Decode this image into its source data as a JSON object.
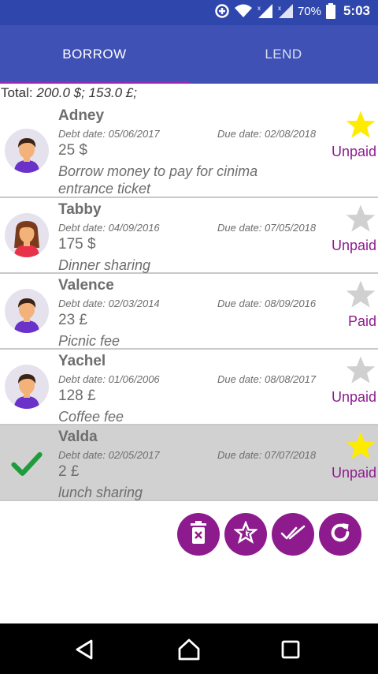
{
  "status_bar": {
    "battery": "70%",
    "time": "5:03"
  },
  "tabs": [
    {
      "label": "BORROW"
    },
    {
      "label": "LEND"
    }
  ],
  "total": {
    "label": "Total:",
    "value": "200.0 $; 153.0 £;"
  },
  "debts": [
    {
      "name": "Adney",
      "debt_date": "Debt date: 05/06/2017",
      "due_date": "Due date: 02/08/2018",
      "amount": "25 $",
      "description": "Borrow money to pay for cinima entrance ticket",
      "status": "Unpaid",
      "starred": true,
      "avatar": "male-avatar"
    },
    {
      "name": "Tabby",
      "debt_date": "Debt date: 04/09/2016",
      "due_date": "Due date: 07/05/2018",
      "amount": "175 $",
      "description": "Dinner sharing",
      "status": "Unpaid",
      "starred": false,
      "avatar": "female-avatar"
    },
    {
      "name": "Valence",
      "debt_date": "Debt date: 02/03/2014",
      "due_date": "Due date: 08/09/2016",
      "amount": "23 £",
      "description": "Picnic fee",
      "status": "Paid",
      "starred": false,
      "avatar": "male-avatar"
    },
    {
      "name": "Yachel",
      "debt_date": "Debt date: 01/06/2006",
      "due_date": "Due date: 08/08/2017",
      "amount": "128 £",
      "description": "Coffee fee",
      "status": "Unpaid",
      "starred": false,
      "avatar": "male-avatar"
    },
    {
      "name": "Valda",
      "debt_date": "Debt date: 02/05/2017",
      "due_date": "Due date: 07/07/2018",
      "amount": "2 £",
      "description": "lunch sharing",
      "status": "Unpaid",
      "starred": true,
      "selected": true,
      "avatar": "check-icon"
    }
  ],
  "actions": [
    {
      "name": "delete-button",
      "icon": "delete-icon"
    },
    {
      "name": "mark-star-button",
      "icon": "star-icon"
    },
    {
      "name": "mark-paid-button",
      "icon": "double-check-icon"
    },
    {
      "name": "refresh-button",
      "icon": "refresh-icon"
    }
  ],
  "colors": {
    "app_bar": "#3f51b5",
    "status_bar": "#2f46ad",
    "accent": "#8e1b8e",
    "star_on": "#ffeb00",
    "star_off": "#d0d0d0",
    "selected_row": "#d1d1d1"
  }
}
